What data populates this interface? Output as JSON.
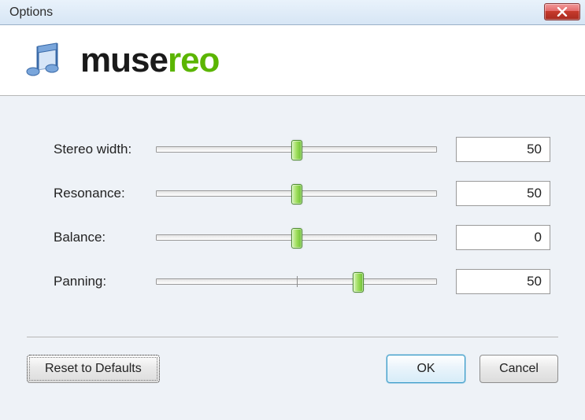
{
  "window": {
    "title": "Options"
  },
  "brand": {
    "part1": "muse",
    "part2": "reo"
  },
  "sliders": [
    {
      "label": "Stereo width:",
      "value": 50,
      "thumb_percent": 50,
      "show_center_tick": false
    },
    {
      "label": "Resonance:",
      "value": 50,
      "thumb_percent": 50,
      "show_center_tick": false
    },
    {
      "label": "Balance:",
      "value": 0,
      "thumb_percent": 50,
      "show_center_tick": true
    },
    {
      "label": "Panning:",
      "value": 50,
      "thumb_percent": 72,
      "show_center_tick": true
    }
  ],
  "buttons": {
    "reset": "Reset to Defaults",
    "ok": "OK",
    "cancel": "Cancel"
  }
}
